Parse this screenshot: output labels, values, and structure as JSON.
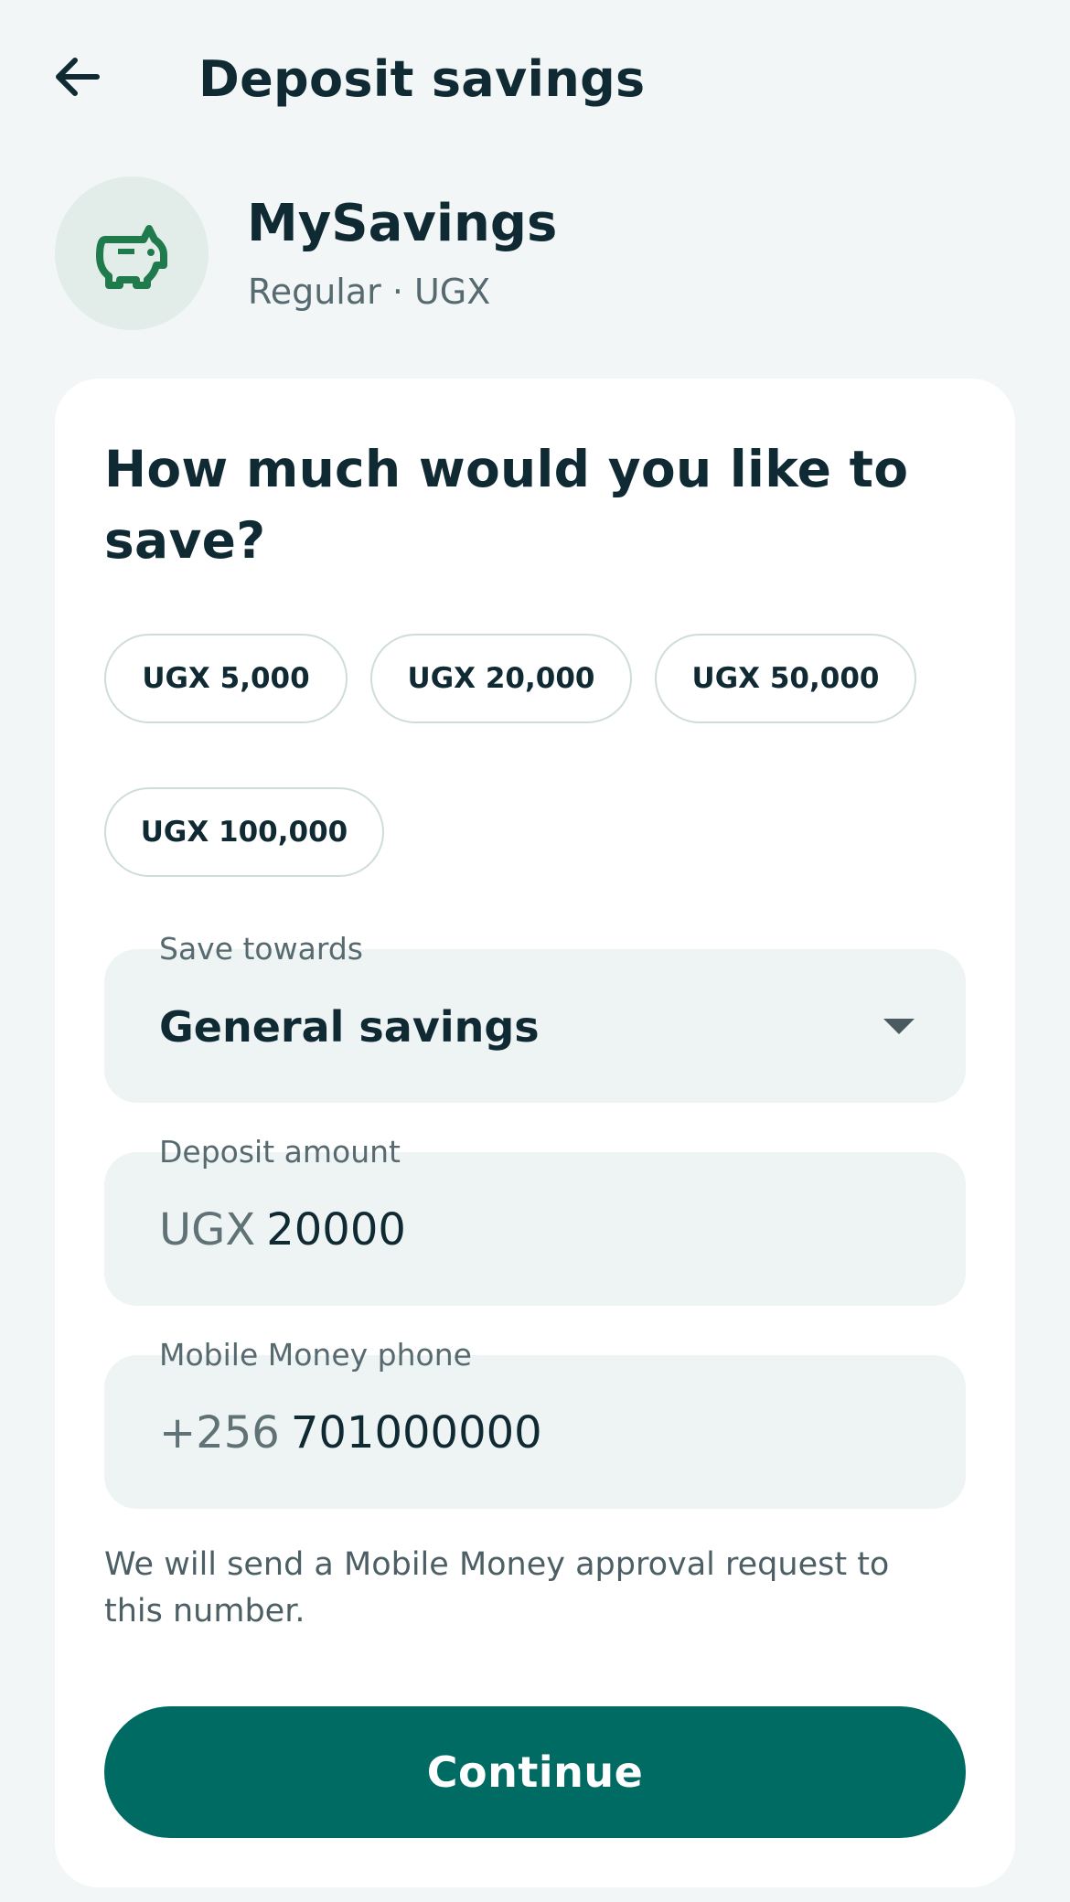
{
  "header": {
    "title": "Deposit savings",
    "back_icon": "arrow-left-icon"
  },
  "account": {
    "name": "MySavings",
    "subtitle": "Regular · UGX",
    "icon": "piggy-bank-icon",
    "icon_color": "#1f7a4c"
  },
  "form": {
    "question": "How much would you like to save?",
    "quick_amounts": [
      "UGX 5,000",
      "UGX 20,000",
      "UGX 50,000",
      "UGX 100,000"
    ],
    "save_towards": {
      "label": "Save towards",
      "value": "General savings"
    },
    "deposit_amount": {
      "label": "Deposit amount",
      "prefix": "UGX",
      "value": "20000"
    },
    "phone": {
      "label": "Mobile Money phone",
      "prefix": "+256",
      "value": "701000000"
    },
    "helper_text": "We will send a Mobile Money approval request to this number.",
    "continue_label": "Continue"
  },
  "colors": {
    "background": "#f2f6f6",
    "primary": "#006b63",
    "field_background": "#eef3f3",
    "text": "#102a33"
  }
}
